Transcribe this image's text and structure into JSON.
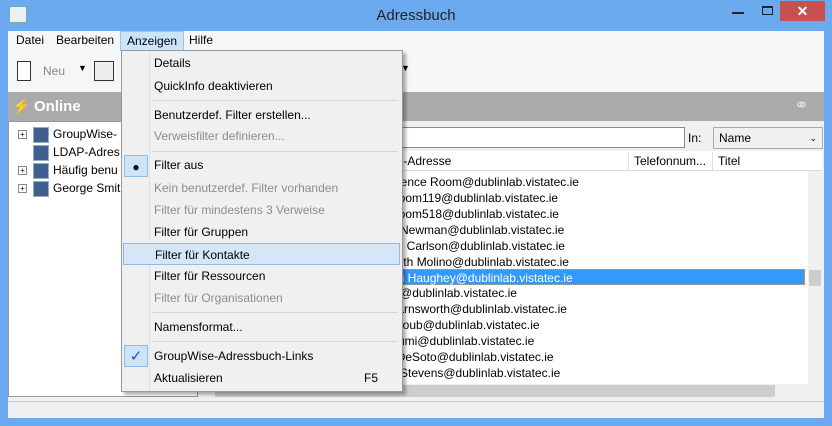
{
  "window": {
    "title": "Adressbuch",
    "close": "✕"
  },
  "menubar": [
    "Datei",
    "Bearbeiten",
    "Anzeigen",
    "Hilfe"
  ],
  "toolbar": {
    "new_label": "Neu"
  },
  "online": {
    "label": "Online"
  },
  "tree": [
    "GroupWise-",
    "LDAP-Adres",
    "Häufig benu",
    "George Smit"
  ],
  "search": {
    "value": "",
    "in_label": "In:",
    "field": "Name"
  },
  "columns": [
    "il-Adresse",
    "Telefonnum...",
    "Titel"
  ],
  "rows": [
    "erence Room@dublinlab.vistatec.ie",
    "Room119@dublinlab.vistatec.ie",
    "Room518@dublinlab.vistatec.ie",
    "g Newman@dublinlab.vistatec.ie",
    "ne Carlson@dublinlab.vistatec.ie",
    "beth Molino@dublinlab.vistatec.ie",
    "an Haughey@dublinlab.vistatec.ie",
    "th@dublinlab.vistatec.ie",
    "Farnsworth@dublinlab.vistatec.ie",
    "acoub@dublinlab.vistatec.ie",
    "Sumi@dublinlab.vistatec.ie",
    "t DeSoto@dublinlab.vistatec.ie",
    "n Stevens@dublinlab.vistatec.ie"
  ],
  "menu": {
    "details": "Details",
    "quickinfo": "QuickInfo deaktivieren",
    "custom_filter": "Benutzerdef. Filter erstellen...",
    "ref_filter": "Verweisfilter definieren...",
    "filter_off": "Filter aus",
    "no_custom": "Kein benutzerdef. Filter vorhanden",
    "min3": "Filter für mindestens 3 Verweise",
    "groups": "Filter für Gruppen",
    "contacts": "Filter für Kontakte",
    "resources": "Filter für Ressourcen",
    "orgs": "Filter für Organisationen",
    "nameformat": "Namensformat...",
    "links": "GroupWise-Adressbuch-Links",
    "refresh": "Aktualisieren",
    "refresh_shortcut": "F5"
  }
}
